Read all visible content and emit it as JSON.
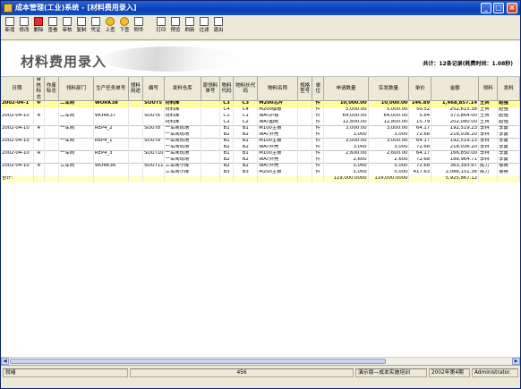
{
  "window": {
    "title": "成本管理(工业)系统 - [材料费用录入]",
    "minimize": "_",
    "maximize": "□",
    "close": "×"
  },
  "toolbar": [
    {
      "label": "新增",
      "icon": "new-doc-icon"
    },
    {
      "label": "修改",
      "icon": "edit-icon"
    },
    {
      "label": "删除",
      "icon": "delete-icon"
    },
    {
      "label": "查看",
      "icon": "view-icon"
    },
    {
      "label": "审核",
      "icon": "audit-icon"
    },
    {
      "label": "复制",
      "icon": "copy-icon"
    },
    {
      "label": "凭证",
      "icon": "voucher-icon"
    },
    {
      "label": "上查",
      "icon": "up-query-icon"
    },
    {
      "label": "下查",
      "icon": "down-query-icon"
    },
    {
      "label": "附件",
      "icon": "attach-icon"
    },
    {
      "label": "打印",
      "icon": "print-icon"
    },
    {
      "label": "预览",
      "icon": "preview-icon"
    },
    {
      "label": "刷新",
      "icon": "refresh-icon"
    },
    {
      "label": "过滤",
      "icon": "filter-icon"
    },
    {
      "label": "退出",
      "icon": "exit-icon"
    }
  ],
  "header": {
    "title": "材料费用录入",
    "record_info": "共计：12条记录(耗费时间：1.08秒)"
  },
  "grid": {
    "columns": [
      "日期",
      "审核标志",
      "作废标志",
      "领料部门",
      "生产任务单号",
      "领料用途",
      "编号",
      "发料仓库",
      "原领料单号",
      "物料代码",
      "物料长代码",
      "物料名称",
      "规格型号",
      "单位",
      "申请数量",
      "实发数量",
      "单价",
      "金额",
      "领料",
      "发料"
    ],
    "rows": [
      {
        "hl": true,
        "cells": [
          "2002-04-1",
          "※",
          "",
          "二车间",
          "WORK38",
          "",
          "SOUT5",
          "材料库",
          "",
          "C3",
          "C3",
          "M200芯片",
          "",
          "件",
          "10,000.00",
          "10,000.00",
          "146.89",
          "1,468,857.14",
          "王兵",
          "赵强"
        ]
      },
      {
        "cells": [
          "",
          "",
          "",
          "",
          "",
          "",
          "",
          "材料库",
          "",
          "C4",
          "C4",
          "M200模板",
          "",
          "件",
          "5,000.00",
          "5,000.00",
          "50.52",
          "252,615.38",
          "王兵",
          "赵强"
        ]
      },
      {
        "cells": [
          "2002-04-10",
          "※",
          "",
          "二车间",
          "WORK37",
          "",
          "SOUT6",
          "材料库",
          "",
          "C1",
          "C1",
          "WAT护钱",
          "",
          "件",
          "64,000.00",
          "64,000.00",
          "5.84",
          "373,864.00",
          "王兵",
          "赵强"
        ]
      },
      {
        "cells": [
          "",
          "",
          "",
          "",
          "",
          "",
          "",
          "材料库",
          "",
          "C2",
          "C2",
          "WAT图纸",
          "",
          "件",
          "12,800.00",
          "12,800.00",
          "15.79",
          "202,080.00",
          "王兵",
          "赵强"
        ]
      },
      {
        "group": true,
        "cells": [
          "2002-04-10",
          "※",
          "",
          "一车间",
          "REP4_2",
          "",
          "SOUT8",
          "一车间现场",
          "",
          "B1",
          "B1",
          "M100主板",
          "",
          "件",
          "3,000.00",
          "3,000.00",
          "64.17",
          "192,519.23",
          "李林",
          "李勇"
        ]
      },
      {
        "cells": [
          "",
          "",
          "",
          "",
          "",
          "",
          "",
          "一车间现场",
          "",
          "B2",
          "B2",
          "WAT外壳",
          "",
          "件",
          "3,000",
          "3,000",
          "72.68",
          "218,036.20",
          "李林",
          "李勇"
        ]
      },
      {
        "group": true,
        "cells": [
          "2002-04-10",
          "※",
          "",
          "一车间",
          "REP4_1",
          "",
          "SOUT9",
          "一车间现场",
          "",
          "B1",
          "B1",
          "M100主板",
          "",
          "件",
          "3,000.00",
          "3,000.00",
          "64.17",
          "192,519.23",
          "李林",
          "李勇"
        ]
      },
      {
        "cells": [
          "",
          "",
          "",
          "",
          "",
          "",
          "",
          "一车间现场",
          "",
          "B2",
          "B2",
          "WAT外壳",
          "",
          "件",
          "3,000",
          "3,000",
          "72.68",
          "218,036.20",
          "李林",
          "李勇"
        ]
      },
      {
        "group": true,
        "cells": [
          "2002-04-10",
          "※",
          "",
          "一车间",
          "REP4_3",
          "",
          "SOUT10",
          "一车间现场",
          "",
          "B1",
          "B1",
          "M100主板",
          "",
          "件",
          "2,600.00",
          "2,600.00",
          "64.17",
          "166,850.00",
          "李林",
          "李勇"
        ]
      },
      {
        "cells": [
          "",
          "",
          "",
          "",
          "",
          "",
          "",
          "一车间现场",
          "",
          "B2",
          "B2",
          "WAT外壳",
          "",
          "件",
          "2,600",
          "2,600",
          "72.68",
          "188,964.71",
          "李林",
          "李勇"
        ]
      },
      {
        "group": true,
        "cells": [
          "2002-04-10",
          "※",
          "",
          "三车间",
          "WORK36",
          "",
          "SOUT11",
          "三车间小库",
          "",
          "B2",
          "B2",
          "WAT外壳",
          "",
          "件",
          "5,000",
          "5,000",
          "72.68",
          "363,393.67",
          "陈力",
          "徐英"
        ]
      },
      {
        "cells": [
          "",
          "",
          "",
          "",
          "",
          "",
          "",
          "三车间小库",
          "",
          "B3",
          "B3",
          "M200主板",
          "",
          "件",
          "5,000",
          "5,000",
          "417.63",
          "2,088,151.36",
          "陈力",
          "徐英"
        ]
      }
    ],
    "total": {
      "label": "合计:",
      "apply_qty": "119,000.0000",
      "actual_qty": "119,000.0000",
      "amount": "5,925,867.12"
    }
  },
  "statusbar": {
    "ready": "就绪",
    "code": "456",
    "account": "演示版—成本实施培训",
    "period": "2002年第4期",
    "user": "Administrator."
  },
  "colors": {
    "title_bar": "#0a3fb4",
    "highlight_row": "#ffff99",
    "total_row": "#ffffc8"
  }
}
